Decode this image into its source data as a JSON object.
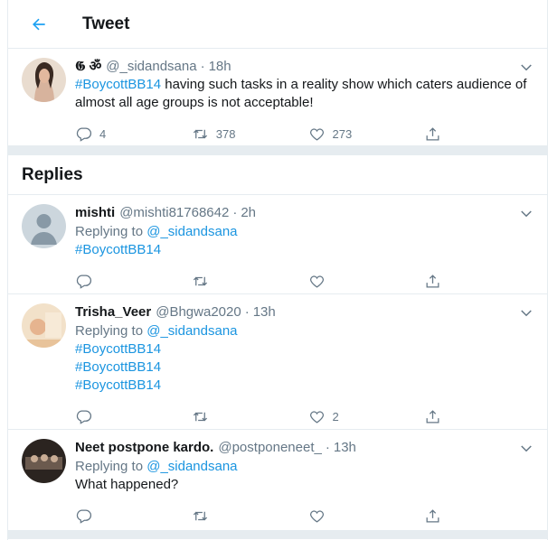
{
  "header": {
    "title": "Tweet"
  },
  "main_tweet": {
    "name_prefix": "𝕲 ॐ",
    "handle": "@_sidandsana",
    "time": "18h",
    "hashtag": "#BoycottBB14",
    "text": " having such tasks in a reality show which caters audience of almost all age groups is not acceptable!",
    "replies": "4",
    "retweets": "378",
    "likes": "273"
  },
  "replies_section": {
    "title": "Replies"
  },
  "replies": [
    {
      "name": "mishti",
      "handle": "@mishti81768642",
      "time": "2h",
      "replying_label": "Replying to",
      "replying_to": "@_sidandsana",
      "lines": [
        "#BoycottBB14"
      ],
      "likes": ""
    },
    {
      "name": "Trisha_Veer",
      "handle": "@Bhgwa2020",
      "time": "13h",
      "replying_label": "Replying to",
      "replying_to": "@_sidandsana",
      "lines": [
        "#BoycottBB14",
        "#BoycottBB14",
        "#BoycottBB14"
      ],
      "likes": "2"
    },
    {
      "name": "Neet postpone kardo.",
      "handle": "@postponeneet_",
      "time": "13h",
      "replying_label": "Replying to",
      "replying_to": "@_sidandsana",
      "text": "What happened?",
      "likes": ""
    }
  ],
  "colors": {
    "accent": "#1da1f2",
    "link": "#1b95e0",
    "muted": "#657786",
    "border": "#e6ecf0"
  },
  "icons": [
    "back-arrow-icon",
    "chevron-down-icon",
    "reply-icon",
    "retweet-icon",
    "like-icon",
    "share-icon"
  ]
}
